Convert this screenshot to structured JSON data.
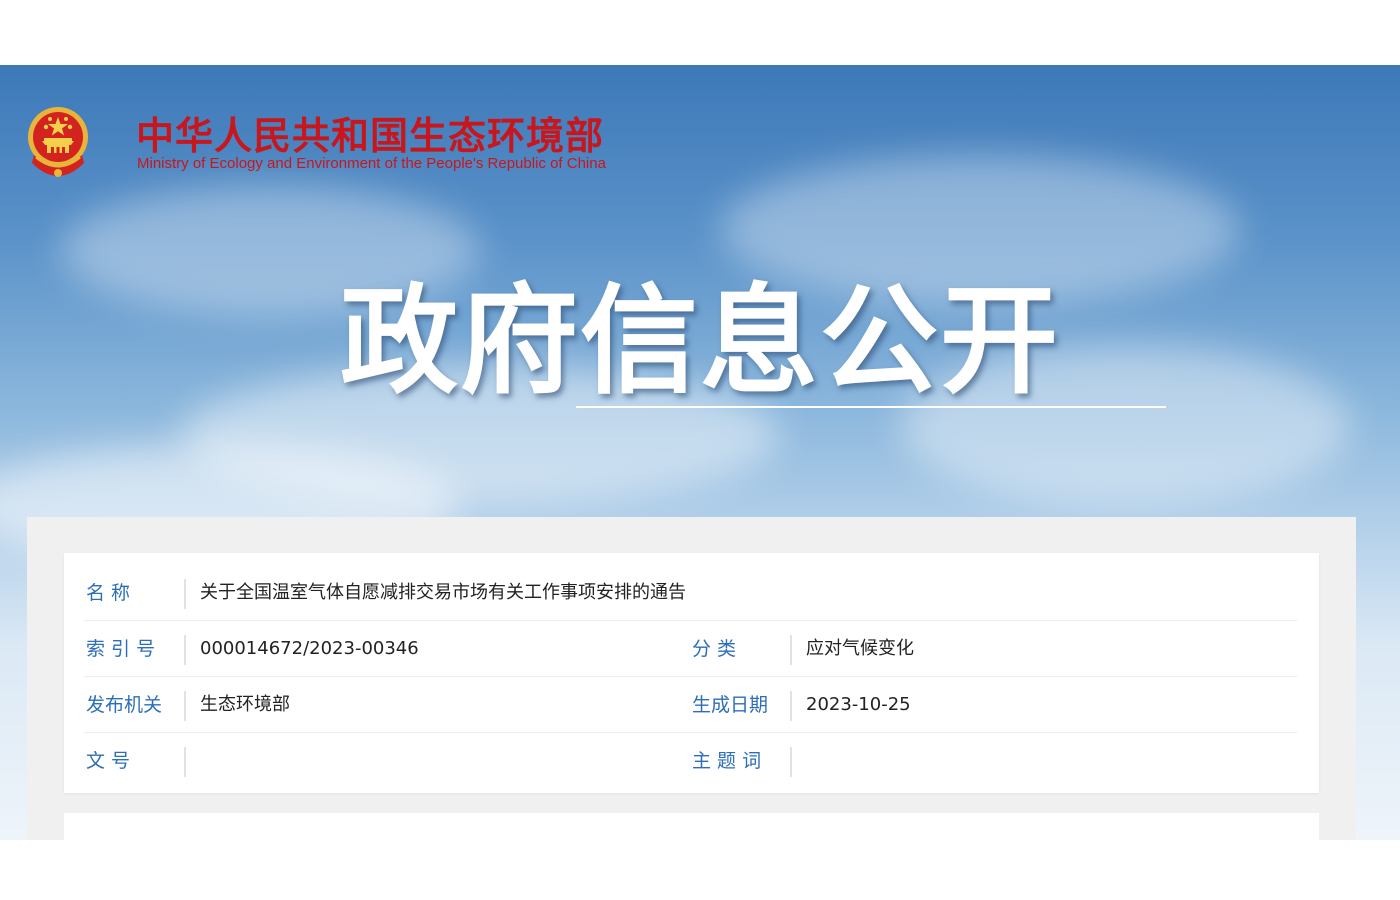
{
  "header": {
    "title_cn": "中华人民共和国生态环境部",
    "title_en": "Ministry of Ecology and Environment of the People's Republic of China"
  },
  "hero": {
    "title": "政府信息公开"
  },
  "info": {
    "name_label": "名      称",
    "name_value": "关于全国温室气体自愿减排交易市场有关工作事项安排的通告",
    "index_label": "索 引 号",
    "index_value": "000014672/2023-00346",
    "category_label": "分      类",
    "category_value": "应对气候变化",
    "issuer_label": "发布机关",
    "issuer_value": "生态环境部",
    "date_label": "生成日期",
    "date_value": "2023-10-25",
    "doc_no_label": "文      号",
    "doc_no_value": "",
    "subject_label": "主 题 词",
    "subject_value": ""
  },
  "colors": {
    "brand_red": "#c8161d",
    "label_blue": "#2c6fb7"
  }
}
